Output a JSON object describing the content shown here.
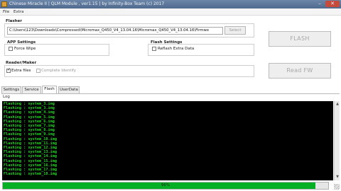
{
  "window": {
    "title": "Chinese Miracle II | QLM Module , ver1.15 | by Infinity-Box Team (c) 2017",
    "min_glyph": "–",
    "close_glyph": "✕"
  },
  "menu": [
    {
      "label": "File"
    },
    {
      "label": "Extra"
    }
  ],
  "flasher": {
    "group_label": "Flasher",
    "path_value": "C:\\Users\\123\\Downloads\\Compressed\\Micromax_Q450_V4_13.04.16\\Micromax_Q450_V4_13.04.16\\Firmwe",
    "select_label": "Select"
  },
  "app_settings": {
    "group_label": "APP Settings",
    "force_wipe_label": "Force Wipe",
    "force_wipe_checked": false
  },
  "flash_settings": {
    "group_label": "Flash Settings",
    "reflash_extra_label": "Reflash Extra Data",
    "reflash_extra_checked": false
  },
  "reader_maker": {
    "group_label": "Reader/Maker",
    "extra_files_label": "Extra files",
    "extra_files_checked": true,
    "complete_identify_label": "Complete Identify",
    "complete_identify_checked": false
  },
  "buttons": {
    "flash_label": "FLASH",
    "read_fw_label": "Read FW"
  },
  "tabs": [
    {
      "label": "Settings",
      "active": false
    },
    {
      "label": "Service",
      "active": false
    },
    {
      "label": "Flash",
      "active": true
    },
    {
      "label": "UserData",
      "active": false
    }
  ],
  "log": {
    "label": "Log",
    "lines": [
      "Flashing : system_3.img",
      "Flashing : system_3.img",
      "Flashing : system_4.img",
      "Flashing : system_5.img",
      "Flashing : system_6.img",
      "Flashing : system_7.img",
      "Flashing : system_8.img",
      "Flashing : system_9.img",
      "Flashing : system_10.img",
      "Flashing : system_11.img",
      "Flashing : system_12.img",
      "Flashing : system_13.img",
      "Flashing : system_14.img",
      "Flashing : system_15.img",
      "Flashing : system_16.img",
      "Flashing : system_17.img",
      "Flashing : system_18.img"
    ]
  },
  "progress": {
    "percent": 96,
    "text": "96%",
    "color": "#06b025"
  }
}
